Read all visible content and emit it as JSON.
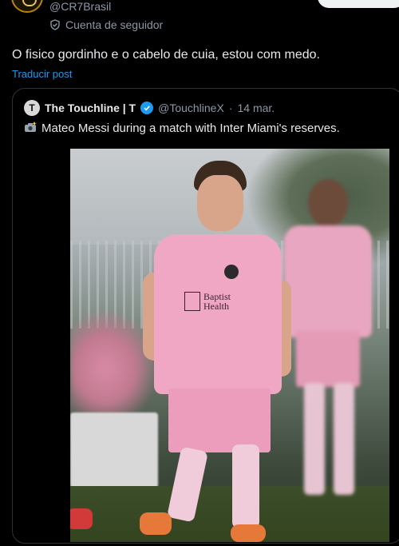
{
  "retweeter": {
    "handle": "@CR7Brasil",
    "follower_label": "Cuenta de seguidor"
  },
  "tweet": {
    "text": "O fisico gordinho e o cabelo de cuia, estou com medo.",
    "translate_label": "Traducir post"
  },
  "quote": {
    "author_name": "The Touchline | T",
    "author_handle": "@TouchlineX",
    "separator": "·",
    "date": "14 mar.",
    "text": "Mateo Messi during a match with Inter Miami's reserves.",
    "avatar_letter": "T"
  },
  "photo": {
    "sponsor_text_1": "Baptist",
    "sponsor_text_2": "Health"
  },
  "colors": {
    "accent": "#1d9bf0",
    "muted": "#8b98a5",
    "text": "#e7e9ea",
    "border": "#2f3336"
  },
  "icons": {
    "follower": "shield-check-icon",
    "verified": "verified-badge-icon",
    "camera": "camera-flash-icon"
  }
}
